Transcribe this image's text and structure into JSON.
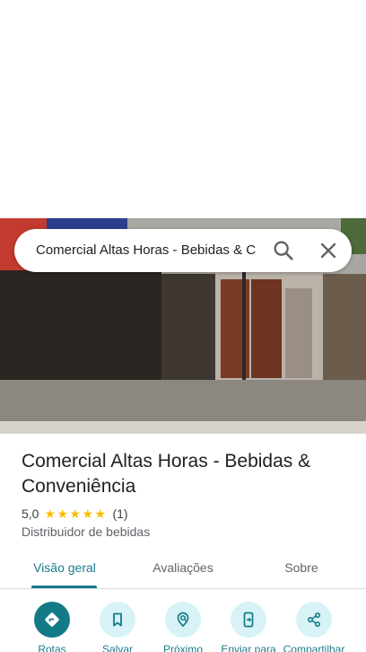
{
  "search": {
    "query": "Comercial Altas Horas - Bebidas & C"
  },
  "place": {
    "title": "Comercial Altas Horas - Bebidas & Conveniência",
    "rating": "5,0",
    "review_count": "(1)",
    "stars": 5,
    "category": "Distribuidor de bebidas"
  },
  "tabs": [
    {
      "label": "Visão geral",
      "active": true
    },
    {
      "label": "Avaliações",
      "active": false
    },
    {
      "label": "Sobre",
      "active": false
    }
  ],
  "actions": [
    {
      "label": "Rotas",
      "icon": "directions-icon"
    },
    {
      "label": "Salvar",
      "icon": "bookmark-icon"
    },
    {
      "label": "Próximo",
      "icon": "nearby-icon"
    },
    {
      "label": "Enviar para",
      "icon": "send-to-phone-icon"
    },
    {
      "label": "Compartilhar",
      "icon": "share-icon"
    }
  ],
  "colors": {
    "accent": "#137b87",
    "accent_light": "#d7f3f7",
    "star": "#fbbc04"
  }
}
